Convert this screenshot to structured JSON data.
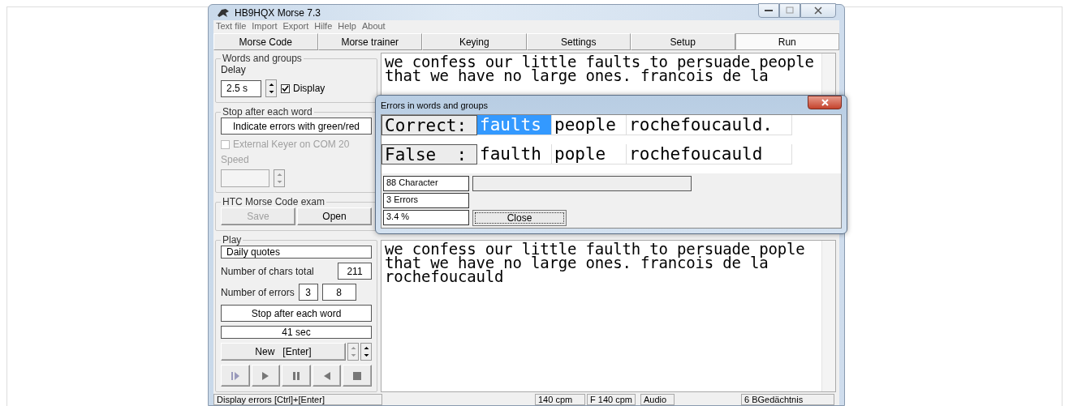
{
  "window": {
    "title": "HB9HQX Morse 7.3"
  },
  "menu": [
    "Text file",
    "Import",
    "Export",
    "Hilfe",
    "Help",
    "About"
  ],
  "tabs": [
    {
      "label": "Morse Code",
      "selected": false
    },
    {
      "label": "Morse trainer",
      "selected": false
    },
    {
      "label": "Keying",
      "selected": false
    },
    {
      "label": "Settings",
      "selected": false
    },
    {
      "label": "Setup",
      "selected": false
    },
    {
      "label": "Run",
      "selected": true
    }
  ],
  "words_and_groups": {
    "title": "Words and groups",
    "delay_label": "Delay",
    "delay_value": "2.5 s",
    "display": {
      "label": "Display",
      "checked": true
    }
  },
  "stop_group": {
    "title": "Stop after each word",
    "indicate_button": "Indicate errors with green/red",
    "external_keyer": {
      "label": "External Keyer on COM 20",
      "checked": false,
      "disabled": true
    },
    "speed_label": "Speed"
  },
  "exam": {
    "title": "HTC Morse Code exam",
    "buttons": [
      {
        "label": "Save",
        "disabled": true
      },
      {
        "label": "Open",
        "disabled": false
      }
    ]
  },
  "play": {
    "title": "Play",
    "source": "Daily quotes",
    "chars_label": "Number of chars total",
    "chars_value": "211",
    "errors_label": "Number of errors",
    "errors_values": [
      "3",
      "8"
    ],
    "stop_button": "Stop after each word",
    "time": "41 sec",
    "new_button": "New   [Enter]"
  },
  "original_text": [
    "we confess our little faults to persuade people",
    "that we have no large ones. francois de la"
  ],
  "received_text": [
    "we confess our little faulth to persuade pople",
    "that we have no large ones. francois de la",
    "rochefoucauld"
  ],
  "dialog": {
    "title": "Errors in words and groups",
    "rows": [
      {
        "label": "Correct:",
        "words": [
          {
            "text": "faults",
            "selected": true
          },
          {
            "text": "people",
            "selected": false
          },
          {
            "text": "rochefoucauld.",
            "selected": false
          }
        ]
      },
      {
        "label": "False  :",
        "words": [
          {
            "text": "faulth",
            "selected": false
          },
          {
            "text": "pople",
            "selected": false
          },
          {
            "text": "rochefoucauld",
            "selected": false
          }
        ]
      }
    ],
    "stats": [
      "88 Character",
      "3 Errors",
      "3.4 %"
    ],
    "close_button": "Close"
  },
  "status_bar": [
    "Display errors   [Ctrl]+[Enter]",
    "140 cpm",
    "F 140 cpm",
    "Audio",
    "6 BGedächtnis"
  ]
}
